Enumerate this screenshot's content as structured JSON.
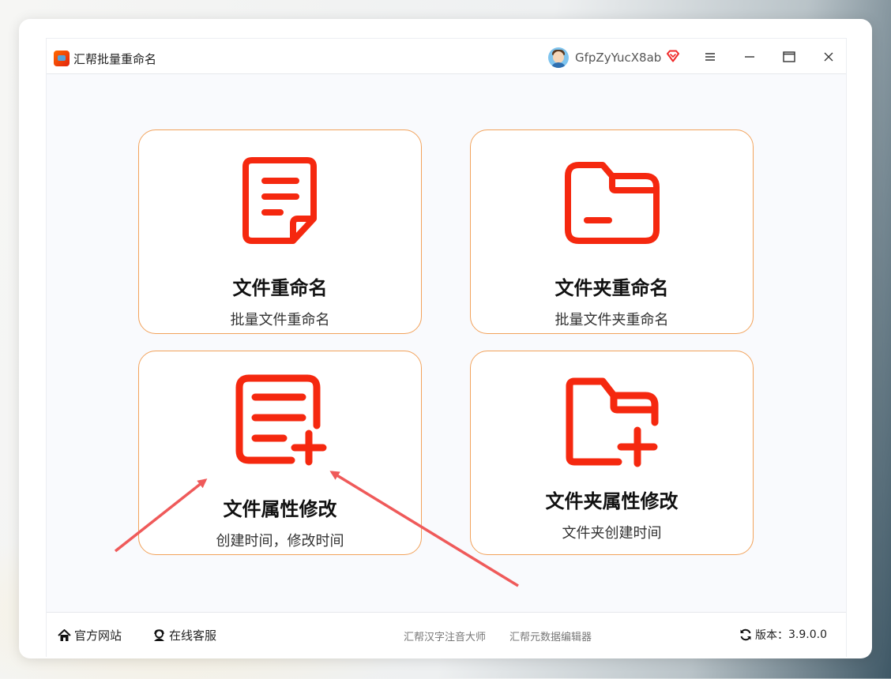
{
  "app": {
    "title": "汇帮批量重命名",
    "username": "GfpZyYucX8ab"
  },
  "icons": {
    "app_logo": "app-logo-icon",
    "avatar": "avatar",
    "vip": "diamond-icon",
    "menu": "hamburger-menu-icon",
    "minimize": "minimize-icon",
    "maximize": "maximize-icon",
    "close": "close-icon",
    "home": "home-icon",
    "support": "support-agent-icon",
    "refresh": "refresh-icon"
  },
  "colors": {
    "accent": "#f5280f",
    "card_border": "#f2a25b",
    "arrow": "#ef5a5a"
  },
  "cards": [
    {
      "title": "文件重命名",
      "subtitle": "批量文件重命名",
      "icon": "document-icon"
    },
    {
      "title": "文件夹重命名",
      "subtitle": "批量文件夹重命名",
      "icon": "folder-icon"
    },
    {
      "title": "文件属性修改",
      "subtitle": "创建时间，修改时间",
      "icon": "document-add-icon"
    },
    {
      "title": "文件夹属性修改",
      "subtitle": "文件夹创建时间",
      "icon": "folder-add-icon"
    }
  ],
  "footer": {
    "official_site": "官方网站",
    "online_support": "在线客服",
    "tool1": "汇帮汉字注音大师",
    "tool2": "汇帮元数据编辑器",
    "version_label": "版本：",
    "version_value": "3.9.0.0"
  }
}
